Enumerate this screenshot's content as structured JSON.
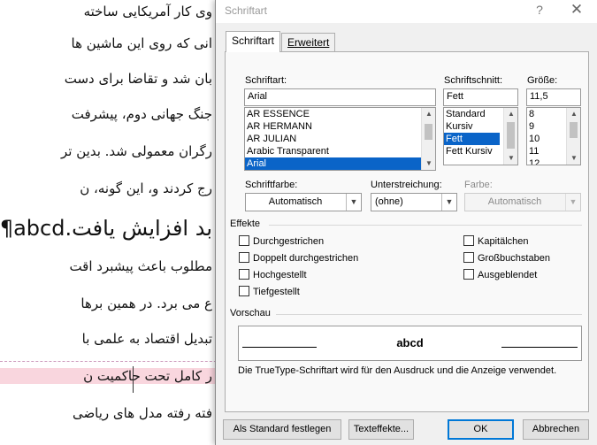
{
  "document": {
    "lines": [
      "وی کار آمریکایی ساخته",
      "انی که روی این ماشین ها",
      "بان شد و تقاضا برای دست",
      "جنگ جهانی دوم، پیشرفت",
      "رگران معمولی شد. بدین تر",
      "رج کردند و، این گونه، ن",
      "بد افزایش یافت.abcd¶",
      "مطلوب باعث پیشبرد اقت",
      "ع می برد. در همین برها",
      "تبدیل اقتصاد به علمی با",
      "ر کامل تحت حاکمیت ن",
      "فته رفته مدل های ریاضی"
    ]
  },
  "dialog": {
    "title": "Schriftart",
    "help_glyph": "?",
    "close_glyph": "✕",
    "tabs": [
      {
        "label": "Schriftart",
        "active": true
      },
      {
        "label": "Erweitert",
        "active": false
      }
    ],
    "font": {
      "label": "Schriftart:",
      "value": "Arial",
      "options": [
        "AR ESSENCE",
        "AR HERMANN",
        "AR JULIAN",
        "Arabic Transparent",
        "Arial"
      ],
      "selected": "Arial"
    },
    "style": {
      "label": "Schriftschnitt:",
      "value": "Fett",
      "options": [
        "Standard",
        "Kursiv",
        "Fett",
        "Fett Kursiv"
      ],
      "selected": "Fett"
    },
    "size": {
      "label": "Größe:",
      "value": "11,5",
      "options": [
        "8",
        "9",
        "10",
        "11",
        "12"
      ]
    },
    "font_color": {
      "label": "Schriftfarbe:",
      "value": "Automatisch"
    },
    "underline": {
      "label": "Unterstreichung:",
      "value": "(ohne)"
    },
    "underline_color": {
      "label": "Farbe:",
      "value": "Automatisch",
      "disabled": true
    },
    "effects": {
      "title": "Effekte",
      "left": [
        {
          "label": "Durchgestrichen",
          "checked": false
        },
        {
          "label": "Doppelt durchgestrichen",
          "checked": false
        },
        {
          "label": "Hochgestellt",
          "checked": false
        },
        {
          "label": "Tiefgestellt",
          "checked": false
        }
      ],
      "right": [
        {
          "label": "Kapitälchen",
          "checked": false
        },
        {
          "label": "Großbuchstaben",
          "checked": false
        },
        {
          "label": "Ausgeblendet",
          "checked": false
        }
      ]
    },
    "preview": {
      "title": "Vorschau",
      "text": "abcd",
      "note": "Die TrueType-Schriftart wird für den Ausdruck und die Anzeige verwendet."
    },
    "buttons": {
      "default": "Als Standard festlegen",
      "text_effects": "Texteffekte...",
      "ok": "OK",
      "cancel": "Abbrechen"
    },
    "icons": {
      "scroll_up": "chevron-up-icon",
      "scroll_down": "chevron-down-icon",
      "dropdown": "chevron-down-icon"
    },
    "colors": {
      "selection": "#0a64c8",
      "default_button_border": "#0078d7",
      "highlight": "#f9d6de"
    }
  }
}
